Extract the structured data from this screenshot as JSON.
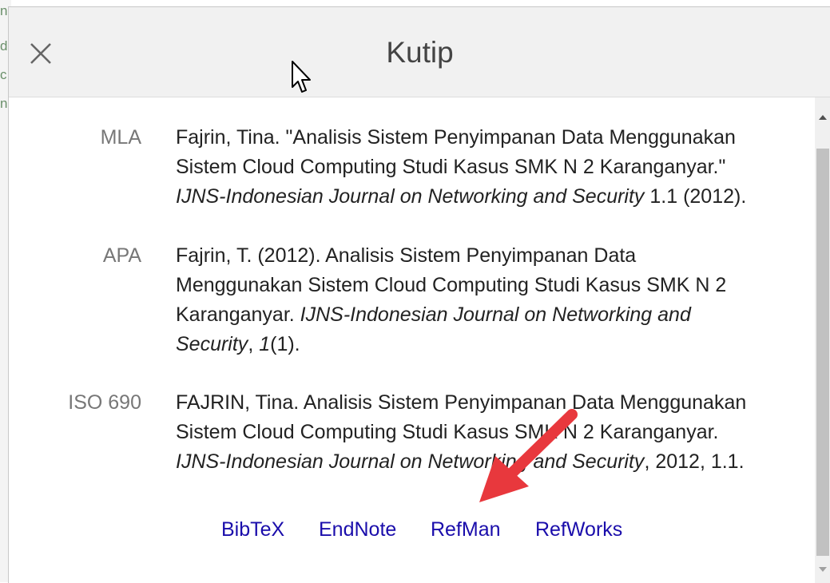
{
  "dialog": {
    "title": "Kutip",
    "close_label": "Close"
  },
  "background_fragments": [
    "n",
    "d",
    "c",
    "n"
  ],
  "citations": [
    {
      "style": "MLA",
      "lines": [
        [
          {
            "t": "Fajrin, Tina. \"Analisis Sistem Penyimpanan Data Menggunakan",
            "i": false
          }
        ],
        [
          {
            "t": "Sistem Cloud Computing Studi Kasus SMK N 2 Karanganyar.\"",
            "i": false
          }
        ],
        [
          {
            "t": "IJNS-Indonesian Journal on Networking and Security",
            "i": true
          },
          {
            "t": " 1.1 (2012).",
            "i": false
          }
        ]
      ]
    },
    {
      "style": "APA",
      "lines": [
        [
          {
            "t": "Fajrin, T. (2012). Analisis Sistem Penyimpanan Data",
            "i": false
          }
        ],
        [
          {
            "t": "Menggunakan Sistem Cloud Computing Studi Kasus SMK N 2",
            "i": false
          }
        ],
        [
          {
            "t": "Karanganyar. ",
            "i": false
          },
          {
            "t": "IJNS-Indonesian Journal on Networking and",
            "i": true
          }
        ],
        [
          {
            "t": "Security",
            "i": true
          },
          {
            "t": ", ",
            "i": false
          },
          {
            "t": "1",
            "i": true
          },
          {
            "t": "(1).",
            "i": false
          }
        ]
      ]
    },
    {
      "style": "ISO 690",
      "lines": [
        [
          {
            "t": "FAJRIN, Tina. Analisis Sistem Penyimpanan Data Menggunakan",
            "i": false
          }
        ],
        [
          {
            "t": "Sistem Cloud Computing Studi Kasus SMK N 2 Karanganyar.",
            "i": false
          }
        ],
        [
          {
            "t": "IJNS-Indonesian Journal on Networking and Security",
            "i": true
          },
          {
            "t": ", 2012, 1.1.",
            "i": false
          }
        ]
      ]
    }
  ],
  "export_links": [
    "BibTeX",
    "EndNote",
    "RefMan",
    "RefWorks"
  ],
  "icons": {
    "close": "close-icon",
    "cursor": "mouse-cursor-icon",
    "annotation": "red-arrow-annotation",
    "scroll_up": "scroll-up-arrow-icon",
    "scroll_down": "scroll-down-arrow-icon"
  },
  "colors": {
    "link": "#1a0dab",
    "annotation_arrow": "#e8383d",
    "header_bg": "#f1f1f1"
  }
}
